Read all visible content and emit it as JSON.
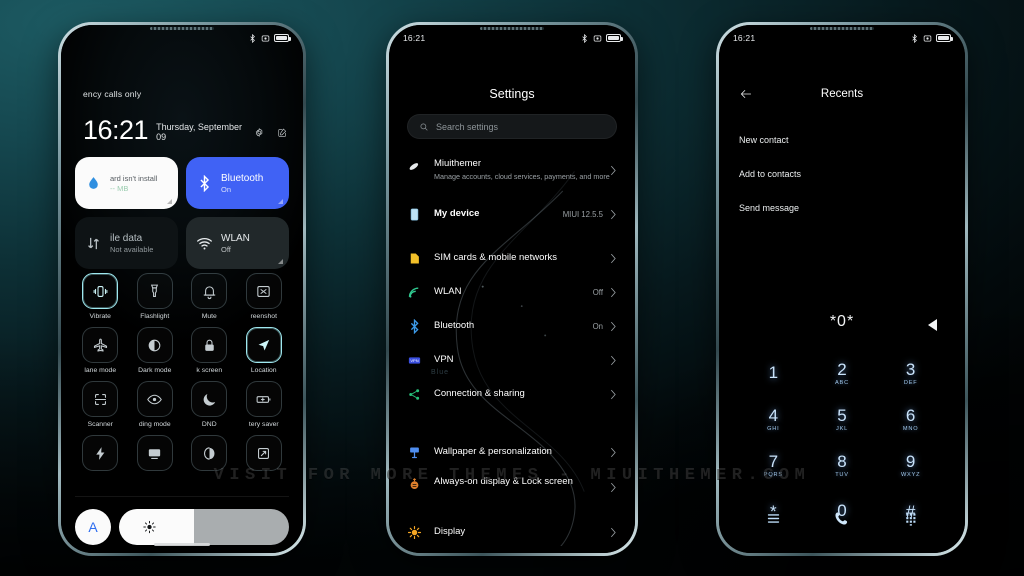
{
  "background": {
    "accent": "#15474f",
    "dark": "#02080a"
  },
  "watermark": {
    "text": "VISIT FOR MORE THEMES - MIUITHEMER.COM"
  },
  "status_bar": {
    "time": "16:21",
    "icons": [
      "bluetooth-icon",
      "alarm-icon",
      "battery-icon"
    ]
  },
  "phone1": {
    "name": "control-center",
    "carrier": "ency calls only",
    "clock": "16:21",
    "date": "Thursday, September 09",
    "icons": {
      "settings": "gear-icon",
      "edit": "edit-icon"
    },
    "big_tiles": [
      {
        "title": "ard isn't install",
        "sub": "-- MB",
        "state": "white",
        "icon": "water-drop-icon"
      },
      {
        "title": "Bluetooth",
        "sub": "On",
        "state": "on",
        "icon": "bluetooth-icon"
      },
      {
        "title": "ile data",
        "sub": "Not available",
        "state": "dim",
        "icon": "mobile-data-icon"
      },
      {
        "title": "WLAN",
        "sub": "Off",
        "state": "grey",
        "icon": "wifi-icon"
      }
    ],
    "tiles": [
      {
        "label": "Vibrate",
        "icon": "vibrate-icon",
        "active": true
      },
      {
        "label": "Flashlight",
        "icon": "flashlight-icon",
        "active": false
      },
      {
        "label": "Mute",
        "icon": "bell-icon",
        "active": false
      },
      {
        "label": "reenshot",
        "icon": "screenshot-icon",
        "active": false
      },
      {
        "label": "lane mode",
        "icon": "airplane-icon",
        "active": false
      },
      {
        "label": "Dark mode",
        "icon": "dark-mode-icon",
        "active": false
      },
      {
        "label": "k screen",
        "icon": "lock-icon",
        "active": false
      },
      {
        "label": "Location",
        "icon": "location-icon",
        "active": true
      },
      {
        "label": "Scanner",
        "icon": "scanner-icon",
        "active": false
      },
      {
        "label": "ding mode",
        "icon": "eye-icon",
        "active": false
      },
      {
        "label": "DND",
        "icon": "moon-icon",
        "active": false
      },
      {
        "label": "tery saver",
        "icon": "battery-saver-icon",
        "active": false
      },
      {
        "label": "",
        "icon": "bolt-icon",
        "active": false
      },
      {
        "label": "",
        "icon": "cast-icon",
        "active": false
      },
      {
        "label": "",
        "icon": "contrast-icon",
        "active": false
      },
      {
        "label": "",
        "icon": "resize-icon",
        "active": false
      }
    ],
    "brightness": {
      "auto_label": "A",
      "icon": "sun-icon",
      "level_percent": 44
    }
  },
  "phone2": {
    "name": "settings",
    "title": "Settings",
    "search_placeholder": "Search settings",
    "ghost_text": "Blue",
    "items": [
      {
        "label": "Miuithemer",
        "desc": "Manage accounts, cloud services, payments, and more",
        "value": "",
        "icon": "account-icon"
      },
      {
        "label": "My device",
        "desc": "",
        "value": "MIUI 12.5.5",
        "icon": "device-icon"
      },
      {
        "label": "SIM cards & mobile networks",
        "desc": "",
        "value": "",
        "icon": "sim-icon"
      },
      {
        "label": "WLAN",
        "desc": "",
        "value": "Off",
        "icon": "wifi-icon"
      },
      {
        "label": "Bluetooth",
        "desc": "",
        "value": "On",
        "icon": "bluetooth-icon"
      },
      {
        "label": "VPN",
        "desc": "",
        "value": "",
        "icon": "vpn-icon"
      },
      {
        "label": "Connection & sharing",
        "desc": "",
        "value": "",
        "icon": "share-icon"
      },
      {
        "label": "Wallpaper & personalization",
        "desc": "",
        "value": "",
        "icon": "wallpaper-icon"
      },
      {
        "label": "Always-on display & Lock screen",
        "desc": "",
        "value": "",
        "icon": "lock-screen-icon"
      },
      {
        "label": "Display",
        "desc": "",
        "value": "",
        "icon": "display-icon"
      }
    ]
  },
  "phone3": {
    "name": "dialer-recents",
    "title": "Recents",
    "back_icon": "arrow-left-icon",
    "menu": [
      "New contact",
      "Add to contacts",
      "Send message"
    ],
    "dialed_number": "*0*",
    "keys": [
      {
        "digit": "1",
        "letters": ""
      },
      {
        "digit": "2",
        "letters": "ABC"
      },
      {
        "digit": "3",
        "letters": "DEF"
      },
      {
        "digit": "4",
        "letters": "GHI"
      },
      {
        "digit": "5",
        "letters": "JKL"
      },
      {
        "digit": "6",
        "letters": "MNO"
      },
      {
        "digit": "7",
        "letters": "PQRS"
      },
      {
        "digit": "8",
        "letters": "TUV"
      },
      {
        "digit": "9",
        "letters": "WXYZ"
      },
      {
        "digit": "*",
        "letters": ""
      },
      {
        "digit": "0",
        "letters": "+"
      },
      {
        "digit": "#",
        "letters": ""
      }
    ],
    "bottom_icons": [
      "menu-icon",
      "call-icon",
      "keypad-icon"
    ]
  }
}
